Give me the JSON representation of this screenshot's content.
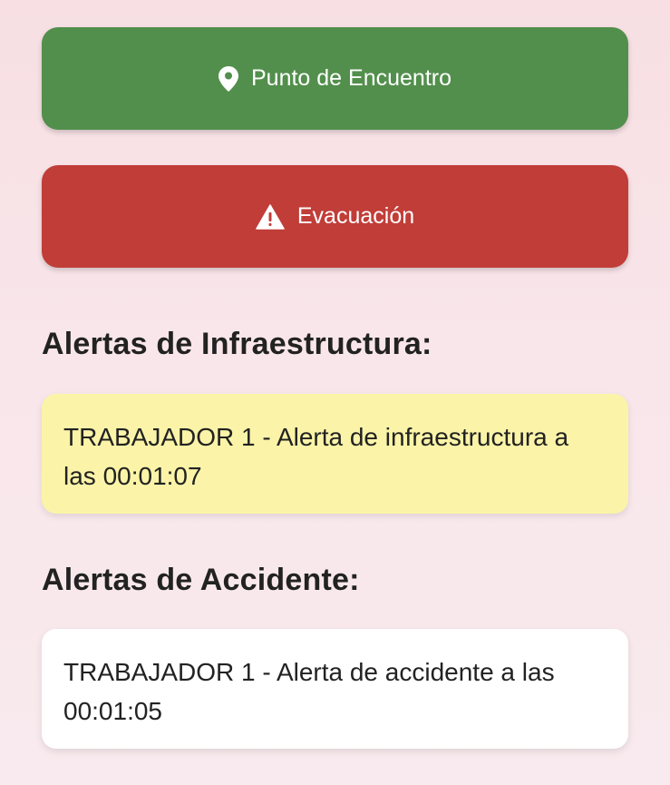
{
  "buttons": {
    "meeting_point": {
      "label": "Punto de Encuentro",
      "icon": "location-pin-icon",
      "color": "#528f4c"
    },
    "evacuation": {
      "label": "Evacuación",
      "icon": "warning-triangle-icon",
      "color": "#c13d38"
    }
  },
  "sections": {
    "infrastructure": {
      "title": "Alertas de Infraestructura:",
      "alerts": [
        {
          "text": "TRABAJADOR 1 - Alerta de infraestructura a las 00:01:07",
          "color": "#fbf4a8"
        }
      ]
    },
    "accident": {
      "title": "Alertas de Accidente:",
      "alerts": [
        {
          "text": "TRABAJADOR 1 - Alerta de accidente a las 00:01:05",
          "color": "#ffffff"
        }
      ]
    }
  }
}
